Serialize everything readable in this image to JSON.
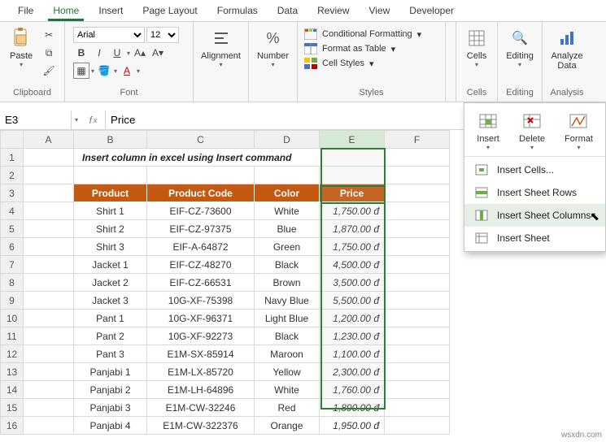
{
  "tabs": [
    "File",
    "Home",
    "Insert",
    "Page Layout",
    "Formulas",
    "Data",
    "Review",
    "View",
    "Developer"
  ],
  "active_tab": "Home",
  "ribbon": {
    "clipboard": {
      "label": "Clipboard",
      "paste": "Paste"
    },
    "font": {
      "label": "Font",
      "family": "Arial",
      "size": "12"
    },
    "alignment": {
      "label": "Alignment",
      "btn": "Alignment"
    },
    "number": {
      "label": "Number",
      "btn": "Number"
    },
    "styles": {
      "label": "Styles",
      "cond": "Conditional Formatting",
      "table": "Format as Table",
      "cell": "Cell Styles"
    },
    "cells": {
      "label": "Cells",
      "btn": "Cells"
    },
    "editing": {
      "label": "Editing",
      "btn": "Editing"
    },
    "analysis": {
      "label": "Analysis",
      "btn": "Analyze Data"
    }
  },
  "formula_bar": {
    "name_box": "E3",
    "formula": "Price"
  },
  "sheet": {
    "columns": [
      "A",
      "B",
      "C",
      "D",
      "E",
      "F"
    ],
    "title": "Insert column in excel using Insert command",
    "headers": {
      "product": "Product",
      "code": "Product Code",
      "color": "Color",
      "price": "Price"
    },
    "rows": [
      {
        "n": 4,
        "product": "Shirt 1",
        "code": "EIF-CZ-73600",
        "color": "White",
        "price": "1,750.00"
      },
      {
        "n": 5,
        "product": "Shirt 2",
        "code": "EIF-CZ-97375",
        "color": "Blue",
        "price": "1,870.00"
      },
      {
        "n": 6,
        "product": "Shirt 3",
        "code": "EIF-A-64872",
        "color": "Green",
        "price": "1,750.00"
      },
      {
        "n": 7,
        "product": "Jacket 1",
        "code": "EIF-CZ-48270",
        "color": "Black",
        "price": "4,500.00"
      },
      {
        "n": 8,
        "product": "Jacket 2",
        "code": "EIF-CZ-66531",
        "color": "Brown",
        "price": "3,500.00"
      },
      {
        "n": 9,
        "product": "Jacket 3",
        "code": "10G-XF-75398",
        "color": "Navy Blue",
        "price": "5,500.00"
      },
      {
        "n": 10,
        "product": "Pant 1",
        "code": "10G-XF-96371",
        "color": "Light Blue",
        "price": "1,200.00"
      },
      {
        "n": 11,
        "product": "Pant 2",
        "code": "10G-XF-92273",
        "color": "Black",
        "price": "1,230.00"
      },
      {
        "n": 12,
        "product": "Pant 3",
        "code": "E1M-SX-85914",
        "color": "Maroon",
        "price": "1,100.00"
      },
      {
        "n": 13,
        "product": "Panjabi 1",
        "code": "E1M-LX-85720",
        "color": "Yellow",
        "price": "2,300.00"
      },
      {
        "n": 14,
        "product": "Panjabi 2",
        "code": "E1M-LH-64896",
        "color": "White",
        "price": "1,760.00"
      },
      {
        "n": 15,
        "product": "Panjabi 3",
        "code": "E1M-CW-32246",
        "color": "Red",
        "price": "1,890.00"
      },
      {
        "n": 16,
        "product": "Panjabi 4",
        "code": "E1M-CW-322376",
        "color": "Orange",
        "price": "1,950.00"
      }
    ]
  },
  "panel": {
    "insert": "Insert",
    "delete": "Delete",
    "format": "Format",
    "menu": {
      "cells": "Insert Cells...",
      "rows": "Insert Sheet Rows",
      "cols": "Insert Sheet Columns",
      "sheet": "Insert Sheet"
    }
  },
  "watermark": "wsxdn.com"
}
